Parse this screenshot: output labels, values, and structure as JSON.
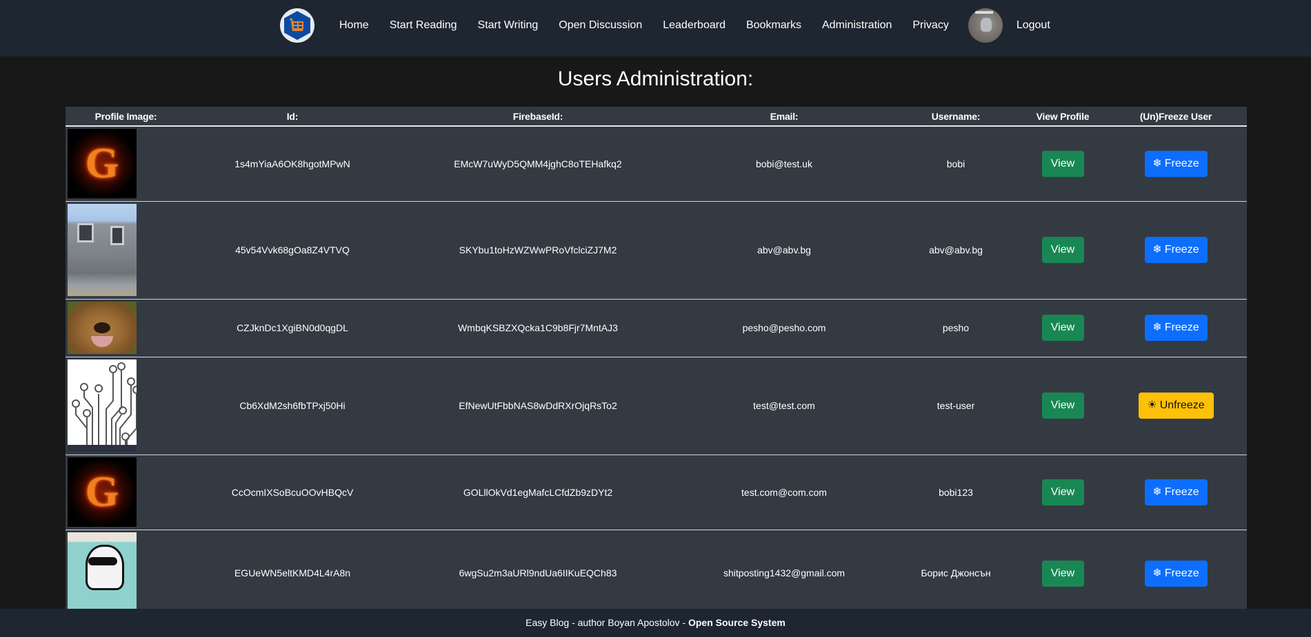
{
  "nav": {
    "logo_icon": "basket-hexagon-logo-icon",
    "links": [
      {
        "label": "Home"
      },
      {
        "label": "Start Reading"
      },
      {
        "label": "Start Writing"
      },
      {
        "label": "Open Discussion"
      },
      {
        "label": "Leaderboard"
      },
      {
        "label": "Bookmarks"
      },
      {
        "label": "Administration"
      },
      {
        "label": "Privacy"
      }
    ],
    "avatar": "user-avatar",
    "logout_label": "Logout"
  },
  "page": {
    "title": "Users Administration:"
  },
  "table": {
    "headers": [
      "Profile Image:",
      "Id:",
      "FirebaseId:",
      "Email:",
      "Username:",
      "View Profile",
      "(Un)Freeze User"
    ],
    "rows": [
      {
        "image": "fire-letter-g",
        "id": "1s4mYiaA6OK8hgotMPwN",
        "firebase_id": "EMcW7uWyD5QMM4jghC8oTEHafkq2",
        "email": "bobi@test.uk",
        "username": "bobi",
        "view_label": "View",
        "freeze_label": "Freeze",
        "freeze_icon": "❄",
        "frozen": false
      },
      {
        "image": "house",
        "id": "45v54Vvk68gOa8Z4VTVQ",
        "firebase_id": "SKYbu1toHzWZWwPRoVfclciZJ7M2",
        "email": "abv@abv.bg",
        "username": "abv@abv.bg",
        "view_label": "View",
        "freeze_label": "Freeze",
        "freeze_icon": "❄",
        "frozen": false
      },
      {
        "image": "bear",
        "id": "CZJknDc1XgiBN0d0qgDL",
        "firebase_id": "WmbqKSBZXQcka1C9b8Fjr7MntAJ3",
        "email": "pesho@pesho.com",
        "username": "pesho",
        "view_label": "View",
        "freeze_label": "Freeze",
        "freeze_icon": "❄",
        "frozen": false
      },
      {
        "image": "circuit",
        "id": "Cb6XdM2sh6fbTPxj50Hi",
        "firebase_id": "EfNewUtFbbNAS8wDdRXrOjqRsTo2",
        "email": "test@test.com",
        "username": "test-user",
        "view_label": "View",
        "freeze_label": "Unfreeze",
        "freeze_icon": "☀",
        "frozen": true
      },
      {
        "image": "fire-letter-g",
        "id": "CcOcmIXSoBcuOOvHBQcV",
        "firebase_id": "GOLllOkVd1egMafcLCfdZb9zDYt2",
        "email": "test.com@com.com",
        "username": "bobi123",
        "view_label": "View",
        "freeze_label": "Freeze",
        "freeze_icon": "❄",
        "frozen": false
      },
      {
        "image": "portrait-glasses",
        "id": "EGUeWN5eltKMD4L4rA8n",
        "firebase_id": "6wgSu2m3aURl9ndUa6IIKuEQCh83",
        "email": "shitposting1432@gmail.com",
        "username": "Борис Джонсън",
        "view_label": "View",
        "freeze_label": "Freeze",
        "freeze_icon": "❄",
        "frozen": false
      }
    ]
  },
  "footer": {
    "text": "Easy Blog -  author Boyan Apostolov - ",
    "link_label": "Open Source System"
  },
  "colors": {
    "navbar_bg": "#1e2631",
    "page_bg": "#181818",
    "table_bg": "#343a42",
    "view_button": "#198754",
    "freeze_button": "#0d6efd",
    "unfreeze_button": "#ffc107"
  }
}
